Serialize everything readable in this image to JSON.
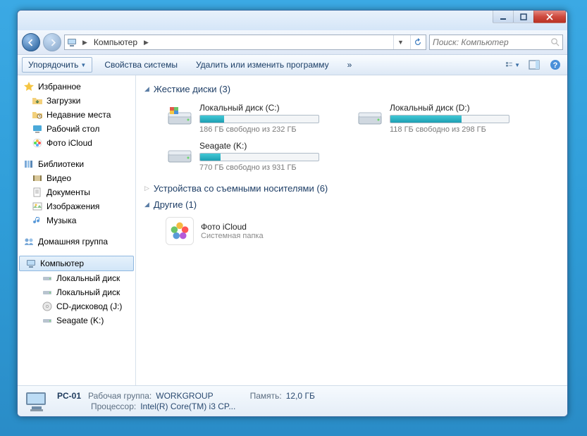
{
  "breadcrumb": {
    "root": "Компьютер"
  },
  "search": {
    "placeholder": "Поиск: Компьютер"
  },
  "toolbar": {
    "organize": "Упорядочить",
    "system_props": "Свойства системы",
    "uninstall": "Удалить или изменить программу",
    "overflow": "»"
  },
  "sidebar": {
    "favorites": {
      "title": "Избранное",
      "items": [
        "Загрузки",
        "Недавние места",
        "Рабочий стол",
        "Фото iCloud"
      ]
    },
    "libraries": {
      "title": "Библиотеки",
      "items": [
        "Видео",
        "Документы",
        "Изображения",
        "Музыка"
      ]
    },
    "homegroup": {
      "title": "Домашняя группа"
    },
    "computer": {
      "title": "Компьютер",
      "items": [
        "Локальный диск",
        "Локальный диск",
        "CD-дисковод (J:)",
        "Seagate (K:)"
      ]
    }
  },
  "sections": {
    "drives": {
      "title": "Жесткие диски (3)"
    },
    "removable": {
      "title": "Устройства со съемными носителями (6)"
    },
    "other": {
      "title": "Другие (1)"
    }
  },
  "drives": [
    {
      "name": "Локальный диск (C:)",
      "free_text": "186 ГБ свободно из 232 ГБ",
      "pct": 20
    },
    {
      "name": "Локальный диск (D:)",
      "free_text": "118 ГБ свободно из 298 ГБ",
      "pct": 60
    },
    {
      "name": "Seagate (K:)",
      "free_text": "770 ГБ свободно из 931 ГБ",
      "pct": 17
    }
  ],
  "other_items": [
    {
      "name": "Фото iCloud",
      "sub": "Системная папка"
    }
  ],
  "status": {
    "pc_name": "PC-01",
    "workgroup_label": "Рабочая группа:",
    "workgroup": "WORKGROUP",
    "mem_label": "Память:",
    "mem": "12,0 ГБ",
    "cpu_label": "Процессор:",
    "cpu": "Intel(R) Core(TM) i3 CP..."
  }
}
